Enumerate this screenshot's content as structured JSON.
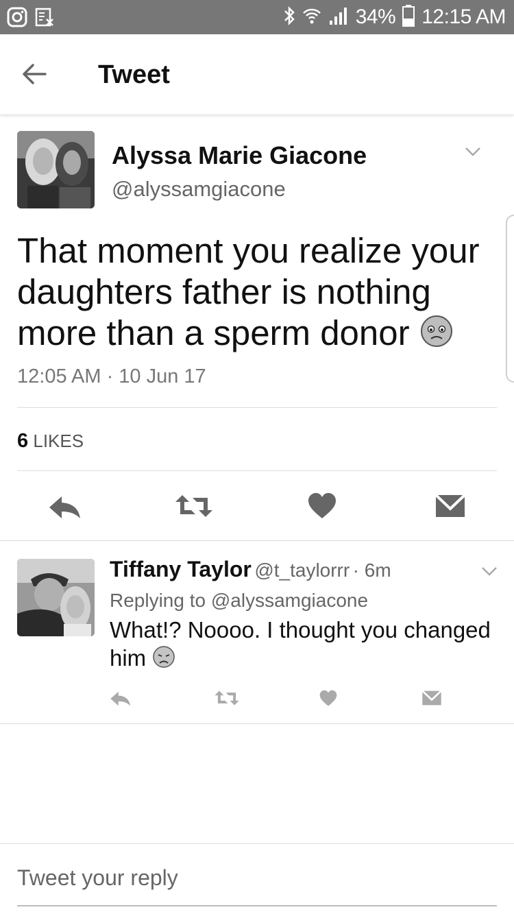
{
  "status_bar": {
    "battery": "34%",
    "time": "12:15 AM",
    "icons": [
      "instagram-icon",
      "fax-icon",
      "bluetooth-icon",
      "wifi-icon",
      "signal-icon",
      "battery-icon"
    ]
  },
  "header": {
    "title": "Tweet",
    "back_icon": "arrow-left-icon"
  },
  "tweet": {
    "author_name": "Alyssa Marie Giacone",
    "author_handle": "@alyssamgiacone",
    "text": "That moment you realize your daughters father is nothing more than a sperm donor",
    "emoji": "pouting-face-emoji",
    "timestamp": "12:05 AM · 10 Jun 17",
    "likes_count": "6",
    "likes_label": "LIKES",
    "actions": [
      "reply-icon",
      "retweet-icon",
      "heart-icon",
      "message-icon"
    ]
  },
  "reply": {
    "author_name": "Tiffany Taylor",
    "author_handle": "@t_taylorrr",
    "age": "· 6m",
    "replying_to": "Replying to @alyssamgiacone",
    "text": "What!? Noooo. I thought you changed him",
    "emoji": "disappointed-face-emoji"
  },
  "compose": {
    "placeholder": "Tweet your reply"
  },
  "colors": {
    "status_bar": "#777777",
    "text": "#111111",
    "muted": "#666666",
    "divider": "#dcdcdc"
  }
}
